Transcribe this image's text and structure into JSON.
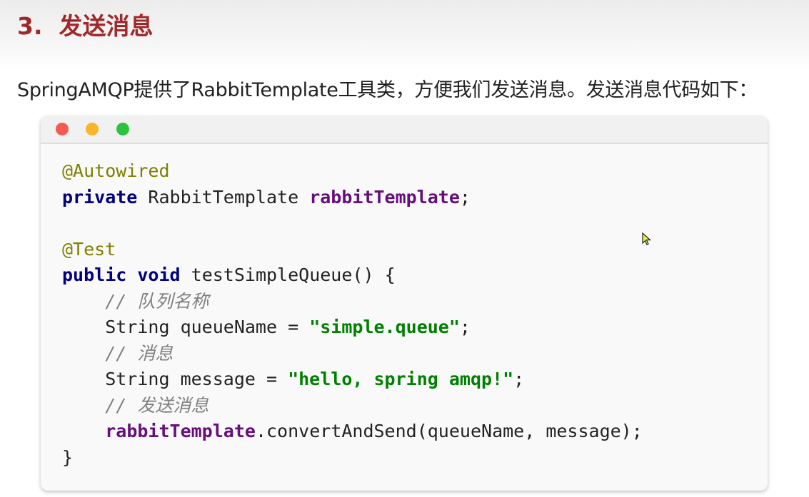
{
  "heading": {
    "number": "3.",
    "title": "发送消息"
  },
  "intro": "SpringAMQP提供了RabbitTemplate工具类，方便我们发送消息。发送消息代码如下：",
  "window_controls": [
    {
      "name": "close",
      "color": "#f45a52"
    },
    {
      "name": "minimize",
      "color": "#f7b52c"
    },
    {
      "name": "maximize",
      "color": "#2cc33f"
    }
  ],
  "code_lines": [
    [
      {
        "t": "@Autowired",
        "c": "annot"
      }
    ],
    [
      {
        "t": "private",
        "c": "kw"
      },
      {
        "t": " RabbitTemplate ",
        "c": "plain"
      },
      {
        "t": "rabbitTemplate",
        "c": "field"
      },
      {
        "t": ";",
        "c": "plain"
      }
    ],
    [],
    [
      {
        "t": "@Test",
        "c": "annot"
      }
    ],
    [
      {
        "t": "public",
        "c": "kw"
      },
      {
        "t": " ",
        "c": "plain"
      },
      {
        "t": "void",
        "c": "kw"
      },
      {
        "t": " testSimpleQueue() {",
        "c": "plain"
      }
    ],
    [
      {
        "t": "    ",
        "c": "plain"
      },
      {
        "t": "// 队列名称",
        "c": "comment"
      }
    ],
    [
      {
        "t": "    String queueName = ",
        "c": "plain"
      },
      {
        "t": "\"simple.queue\"",
        "c": "str"
      },
      {
        "t": ";",
        "c": "plain"
      }
    ],
    [
      {
        "t": "    ",
        "c": "plain"
      },
      {
        "t": "// 消息",
        "c": "comment"
      }
    ],
    [
      {
        "t": "    String message = ",
        "c": "plain"
      },
      {
        "t": "\"hello, spring amqp!\"",
        "c": "str"
      },
      {
        "t": ";",
        "c": "plain"
      }
    ],
    [
      {
        "t": "    ",
        "c": "plain"
      },
      {
        "t": "// 发送消息",
        "c": "comment"
      }
    ],
    [
      {
        "t": "    ",
        "c": "plain"
      },
      {
        "t": "rabbitTemplate",
        "c": "field"
      },
      {
        "t": ".convertAndSend(queueName, message);",
        "c": "plain"
      }
    ],
    [
      {
        "t": "}",
        "c": "plain"
      }
    ]
  ]
}
